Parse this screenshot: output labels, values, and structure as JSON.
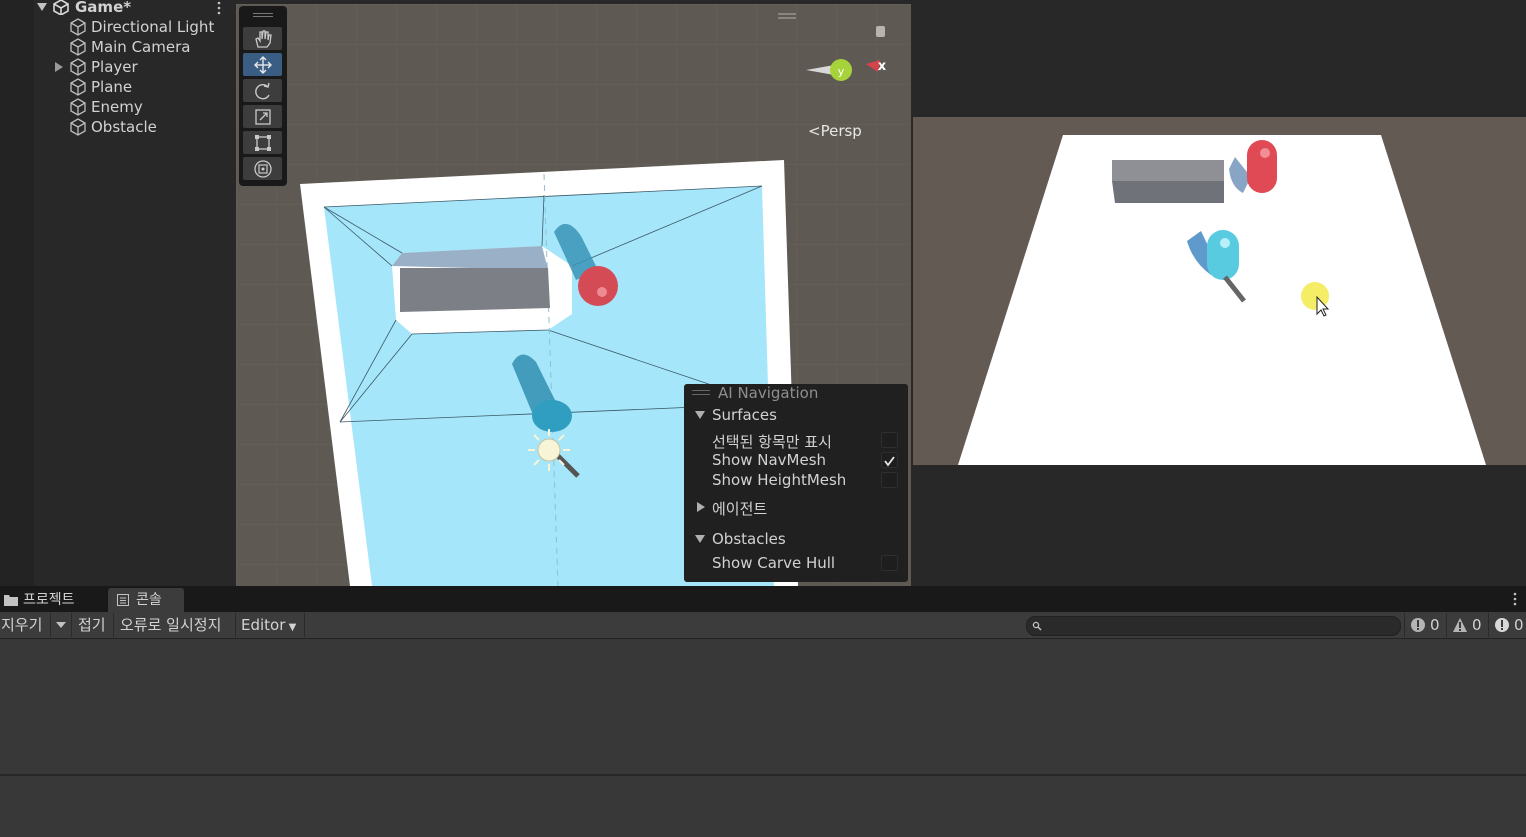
{
  "hierarchy": {
    "scene_name": "Game*",
    "items": [
      {
        "label": "Directional Light",
        "expandable": false
      },
      {
        "label": "Main Camera",
        "expandable": false
      },
      {
        "label": "Player",
        "expandable": true
      },
      {
        "label": "Plane",
        "expandable": false
      },
      {
        "label": "Enemy",
        "expandable": false
      },
      {
        "label": "Obstacle",
        "expandable": false
      }
    ]
  },
  "scene_view": {
    "tools": [
      "hand-tool",
      "move-tool",
      "rotate-tool",
      "scale-tool",
      "rect-tool",
      "transform-tool"
    ],
    "active_tool": "move-tool",
    "gizmo_axes": [
      "y",
      "x"
    ],
    "projection_label": "Persp"
  },
  "ai_navigation": {
    "title": "AI Navigation",
    "surfaces_label": "Surfaces",
    "surfaces_options": [
      {
        "label": "선택된 항목만 표시",
        "checked": false
      },
      {
        "label": "Show NavMesh",
        "checked": true
      },
      {
        "label": "Show HeightMesh",
        "checked": false
      }
    ],
    "agents_label": "에이전트",
    "obstacles_label": "Obstacles",
    "obstacles_options": [
      {
        "label": "Show Carve Hull",
        "checked": false
      }
    ]
  },
  "bottom_panel": {
    "tabs": [
      {
        "label": "프로젝트",
        "icon": "folder-icon",
        "active": false
      },
      {
        "label": "콘솔",
        "icon": "console-icon",
        "active": true
      }
    ],
    "toolbar": {
      "clear": "지우기",
      "collapse": "접기",
      "error_pause": "오류로 일시정지",
      "editor": "Editor"
    },
    "search_placeholder": "",
    "counts": {
      "info": "0",
      "warning": "0",
      "error": "0"
    }
  },
  "colors": {
    "navmesh": "#a6e6fa",
    "active_tool": "#3a5d83",
    "scene_background": "#5f5953",
    "enemy": "#e0505a",
    "player": "#58cbe0"
  }
}
